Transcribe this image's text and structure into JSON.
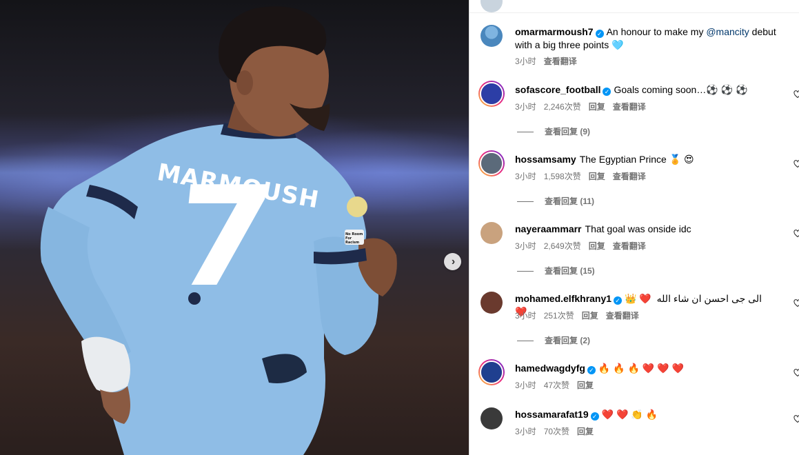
{
  "post": {
    "carousel_next_icon": "chevron-right-icon"
  },
  "photo": {
    "jersey_name": "MARMOUSH",
    "jersey_number": "7",
    "sleeve_badge": "No Room For Racism"
  },
  "caption": {
    "username": "omarmarmoush7",
    "verified": true,
    "text_before": "An honour to make my ",
    "mention": "@mancity",
    "text_after": " debut with a big three points 🩵",
    "time": "3小时",
    "translate": "查看翻译"
  },
  "comments": [
    {
      "username": "sofascore_football",
      "verified": true,
      "text": "Goals coming soon…⚽️ ⚽️ ⚽️",
      "time": "3小时",
      "likes": "2,246次赞",
      "reply": "回复",
      "translate": "查看翻译",
      "view_replies": "查看回复 (9)",
      "avatar_color": "#2c3ea6",
      "story_ring": true
    },
    {
      "username": "hossamsamy",
      "verified": false,
      "text": "The Egyptian Prince 🏅 😍",
      "time": "3小时",
      "likes": "1,598次赞",
      "reply": "回复",
      "translate": "查看翻译",
      "view_replies": "查看回复 (11)",
      "avatar_color": "#5b6a7a",
      "story_ring": true
    },
    {
      "username": "nayeraammarr",
      "verified": false,
      "text": "That goal was onside idc",
      "time": "3小时",
      "likes": "2,649次赞",
      "reply": "回复",
      "translate": "查看翻译",
      "view_replies": "查看回复 (15)",
      "avatar_color": "#c9a27e",
      "story_ring": false
    },
    {
      "username": "mohamed.elfkhrany1",
      "verified": true,
      "text": "👑 ❤️ ❤️",
      "text_rtl": "الى جى احسن ان شاء الله",
      "time": "3小时",
      "likes": "251次赞",
      "reply": "回复",
      "translate": "查看翻译",
      "view_replies": "查看回复 (2)",
      "avatar_color": "#6a3a2e",
      "story_ring": false
    },
    {
      "username": "hamedwagdyfg",
      "verified": true,
      "text": "🔥 🔥 🔥 ❤️ ❤️ ❤️",
      "time": "3小时",
      "likes": "47次赞",
      "reply": "回复",
      "avatar_color": "#1f3f8f",
      "story_ring": true
    },
    {
      "username": "hossamarafat19",
      "verified": true,
      "text": "❤️ ❤️ 👏 🔥",
      "time": "3小时",
      "likes": "70次赞",
      "reply": "回复",
      "avatar_color": "#3a3a3a",
      "story_ring": false
    }
  ],
  "colors": {
    "jersey": "#8fbde6",
    "verified": "#0095f6",
    "meta_text": "#737373",
    "mention": "#00376b"
  }
}
